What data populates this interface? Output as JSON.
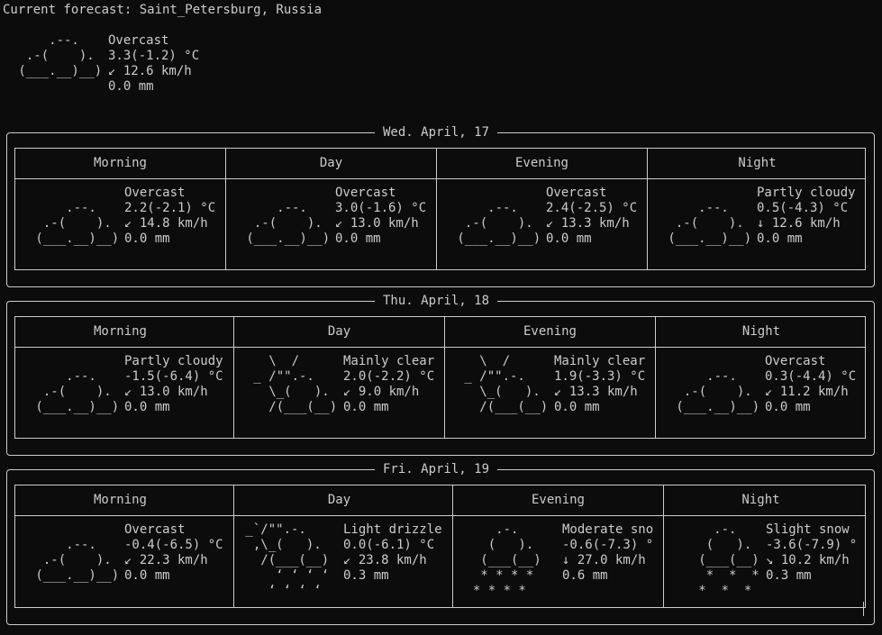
{
  "title": "Current forecast: Saint_Petersburg, Russia",
  "current": {
    "art": "     .--.    \n  .-(    ).  \n (___.__)__) ",
    "info": "Overcast\n3.3(-1.2) °C\n↙ 12.6 km/h\n0.0 mm"
  },
  "days": [
    {
      "label": "Wed. April, 17",
      "periods": [
        {
          "name": "Morning",
          "art": "\n     .--.    \n  .-(    ).  \n (___.__)__) ",
          "info": "Overcast\n2.2(-2.1) °C\n↙ 14.8 km/h\n0.0 mm"
        },
        {
          "name": "Day",
          "art": "\n     .--.    \n  .-(    ).  \n (___.__)__) ",
          "info": "Overcast\n3.0(-1.6) °C\n↙ 13.0 km/h\n0.0 mm"
        },
        {
          "name": "Evening",
          "art": "\n     .--.    \n  .-(    ).  \n (___.__)__) ",
          "info": "Overcast\n2.4(-2.5) °C\n↙ 13.3 km/h\n0.0 mm"
        },
        {
          "name": "Night",
          "art": "\n     .--.    \n  .-(    ).  \n (___.__)__) ",
          "info": "Partly cloudy\n0.5(-4.3) °C\n↓ 12.6 km/h\n0.0 mm"
        }
      ]
    },
    {
      "label": "Thu. April, 18",
      "periods": [
        {
          "name": "Morning",
          "art": "\n     .--.    \n  .-(    ).  \n (___.__)__) ",
          "info": "Partly cloudy\n-1.5(-6.4) °C\n↙ 13.0 km/h\n0.0 mm"
        },
        {
          "name": "Day",
          "art": "   \\  /      \n _ /\"\".-.    \n   \\_(   ).  \n   /(___(__) ",
          "info": "Mainly clear\n2.0(-2.2) °C\n↙ 9.0 km/h\n0.0 mm"
        },
        {
          "name": "Evening",
          "art": "   \\  /      \n _ /\"\".-.    \n   \\_(   ).  \n   /(___(__) ",
          "info": "Mainly clear\n1.9(-3.3) °C\n↙ 13.3 km/h\n0.0 mm"
        },
        {
          "name": "Night",
          "art": "\n     .--.    \n  .-(    ).  \n (___.__)__) ",
          "info": "Overcast\n0.3(-4.4) °C\n↙ 11.2 km/h\n0.0 mm"
        }
      ]
    },
    {
      "label": "Fri. April, 19",
      "periods": [
        {
          "name": "Morning",
          "art": "\n     .--.    \n  .-(    ).  \n (___.__)__) ",
          "info": "Overcast\n-0.4(-6.5) °C\n↙ 22.3 km/h\n0.0 mm"
        },
        {
          "name": "Day",
          "art": " _`/\"\".-.    \n  ,\\_(   ).  \n   /(___(__) \n     ‘ ‘ ‘ ‘ \n    ‘ ‘ ‘ ‘  ",
          "info": "Light drizzle\n0.0(-6.1) °C\n↙ 23.8 km/h\n0.3 mm"
        },
        {
          "name": "Evening",
          "art": "     .-.     \n    (   ).   \n   (___(__)  \n   * * * *   \n  * * * *    ",
          "info": "Moderate sno\n-0.6(-7.3) °\n↓ 27.0 km/h\n0.6 mm"
        },
        {
          "name": "Night",
          "art": "     .-.     \n    (   ).   \n   (___(__)  \n    *  *  *  \n   *  *  *   ",
          "info": "Slight snow\n-3.6(-7.9) °\n↘ 10.2 km/h\n0.3 mm"
        }
      ]
    }
  ]
}
